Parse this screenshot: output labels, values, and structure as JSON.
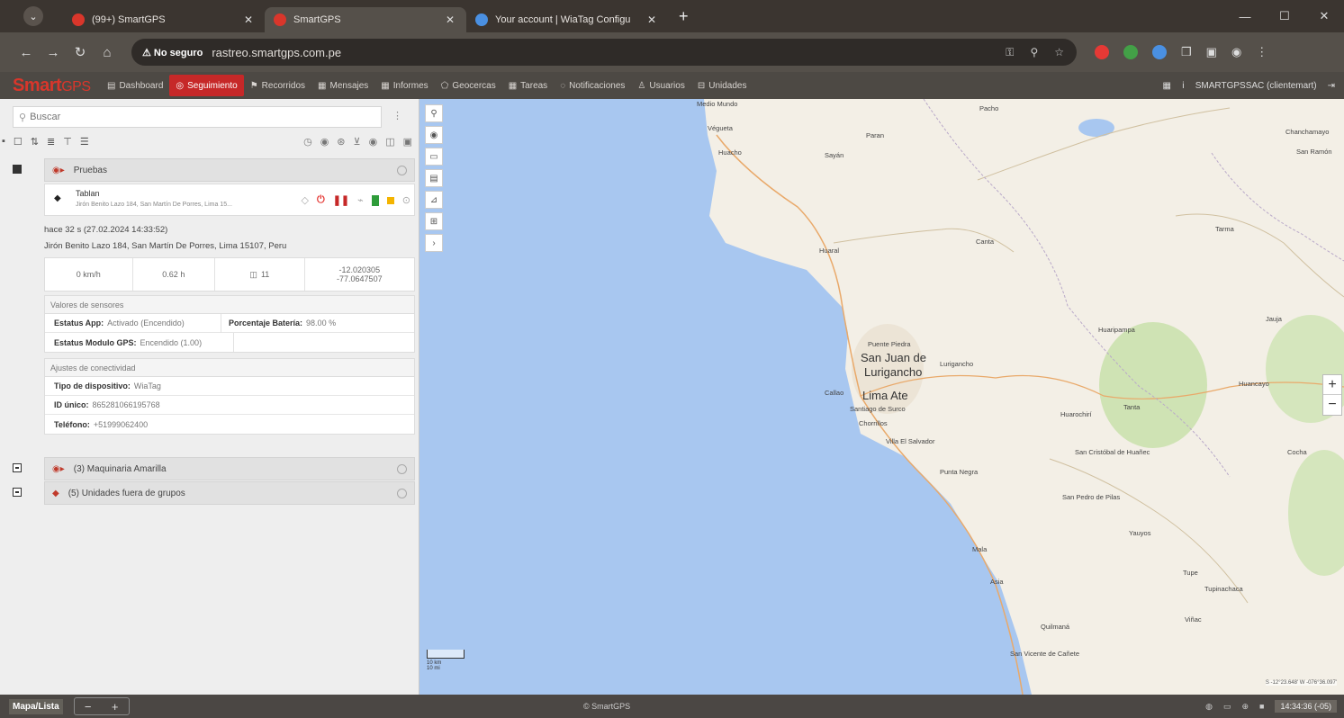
{
  "browser": {
    "tabs": [
      {
        "title": "(99+) SmartGPS",
        "favicon_color": "#d9362b",
        "active": false
      },
      {
        "title": "SmartGPS",
        "favicon_color": "#d9362b",
        "active": true
      },
      {
        "title": "Your account | WiaTag Configu",
        "favicon_color": "#4a90e2",
        "active": false
      }
    ],
    "new_tab": "+",
    "security_label": "⚠ No seguro",
    "url": "rastreo.smartgps.com.pe",
    "window_controls": {
      "minimize": "—",
      "maximize": "☐",
      "close": "✕"
    }
  },
  "app": {
    "logo_smart": "Smart",
    "logo_gps": "GPS",
    "menu": [
      {
        "label": "Dashboard",
        "icon": "dashboard-icon",
        "glyph": "▤"
      },
      {
        "label": "Seguimiento",
        "icon": "target-icon",
        "glyph": "◎",
        "active": true
      },
      {
        "label": "Recorridos",
        "icon": "route-icon",
        "glyph": "⚑"
      },
      {
        "label": "Mensajes",
        "icon": "messages-icon",
        "glyph": "▦"
      },
      {
        "label": "Informes",
        "icon": "reports-icon",
        "glyph": "▦"
      },
      {
        "label": "Geocercas",
        "icon": "geofence-icon",
        "glyph": "⬠"
      },
      {
        "label": "Tareas",
        "icon": "tasks-icon",
        "glyph": "▦"
      },
      {
        "label": "Notificaciones",
        "icon": "bell-icon",
        "glyph": "◌"
      },
      {
        "label": "Usuarios",
        "icon": "users-icon",
        "glyph": "♙"
      },
      {
        "label": "Unidades",
        "icon": "units-icon",
        "glyph": "⊟"
      }
    ],
    "user_label": "SMARTGPSSAC (clientemart)",
    "accent": "#c62828"
  },
  "sidebar": {
    "search_placeholder": "Buscar",
    "groups": [
      {
        "label": "Pruebas",
        "expanded": true,
        "unit": {
          "name": "Tablan",
          "address": "Jirón Benito Lazo 184, San Martín De Porres, Lima 15...",
          "detail_time": "hace 32 s (27.02.2024 14:33:52)",
          "detail_address": "Jirón Benito Lazo 184, San Martín De Porres, Lima 15107, Peru",
          "speed": "0 km/h",
          "altitude": "0.62 h",
          "satellites": "11",
          "lat": "-12.020305",
          "lon": "-77.0647507"
        }
      },
      {
        "label": "(3) Maquinaria Amarilla",
        "expanded": false
      },
      {
        "label": "(5) Unidades fuera de grupos",
        "expanded": false
      }
    ],
    "sensors": {
      "header": "Valores de sensores",
      "app_status_label": "Estatus App:",
      "app_status_value": "Activado (Encendido)",
      "battery_label": "Porcentaje Batería:",
      "battery_value": "98.00 %",
      "gps_status_label": "Estatus Modulo GPS:",
      "gps_status_value": "Encendido (1.00)"
    },
    "connectivity": {
      "header": "Ajustes de conectividad",
      "device_type_label": "Tipo de dispositivo:",
      "device_type_value": "WiaTag",
      "unique_id_label": "ID único:",
      "unique_id_value": "865281066195768",
      "phone_label": "Teléfono:",
      "phone_value": "+51999062400"
    }
  },
  "map": {
    "labels": [
      "Medio Mundo",
      "Végueta",
      "Huacho",
      "Sayán",
      "Pacho",
      "Paran",
      "Huaral",
      "Canta",
      "Puente Piedra",
      "San Juan de",
      "Lurigancho",
      "Lurigancho",
      "Callao",
      "Lima Ate",
      "Santiago de Surco",
      "Chorrillos",
      "Villa El Salvador",
      "Punta Negra",
      "Huarochirí",
      "San Cristóbal de Huañec",
      "San Pedro de Pilas",
      "Mala",
      "Asia",
      "Quilmaná",
      "San Vicente de Cañete",
      "Tupe",
      "Tanta",
      "Yauyos",
      "Chanchamayo",
      "San Ramón",
      "Tarma",
      "Jauja",
      "Huancayo",
      "Viñac",
      "Tupinachaca",
      "Cocha",
      "Huaripampa"
    ],
    "zoom_in": "+",
    "zoom_out": "−",
    "scale_top": "10 km",
    "scale_bottom": "10 mi",
    "coords": "S -12°23.648' W -076°36.097'"
  },
  "footer": {
    "tab_label": "Mapa/Lista",
    "zoom_minus": "−",
    "zoom_plus": "+",
    "brand": "© SmartGPS",
    "clock": "14:34:36 (-05)"
  }
}
